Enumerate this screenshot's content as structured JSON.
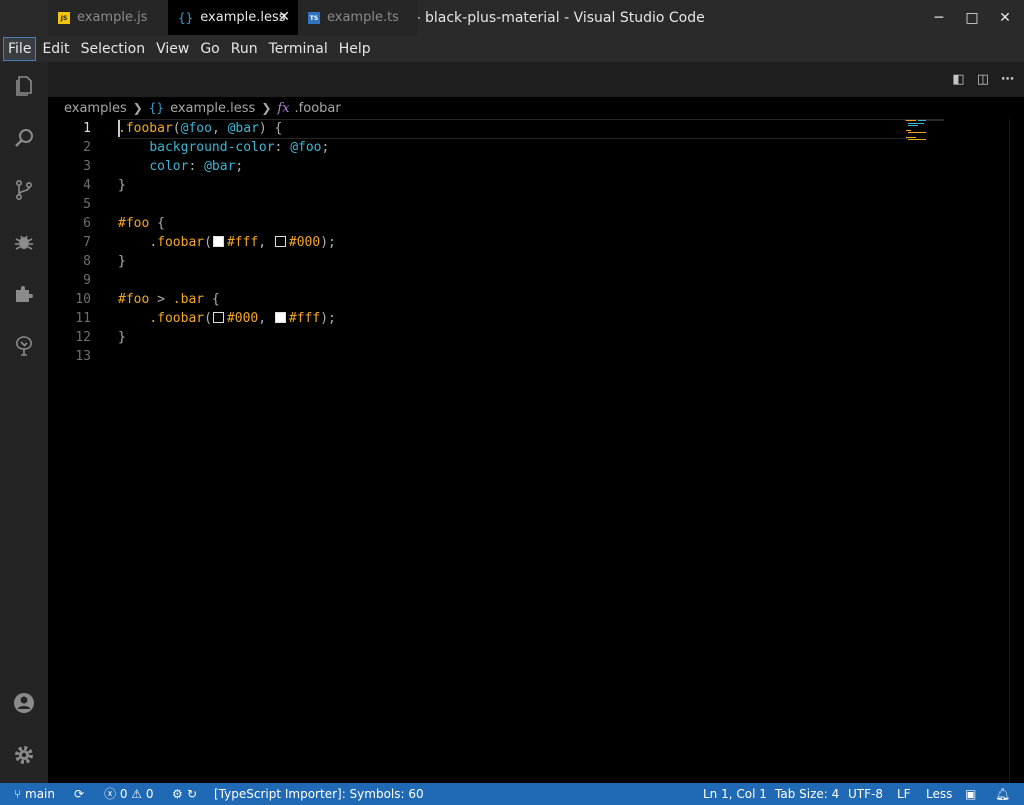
{
  "window": {
    "title": "example.less - black-plus-material - Visual Studio Code",
    "minimize": "─",
    "maximize": "□",
    "close": "✕"
  },
  "menu": [
    "File",
    "Edit",
    "Selection",
    "View",
    "Go",
    "Run",
    "Terminal",
    "Help"
  ],
  "activity_bar": [
    "explorer-icon",
    "search-icon",
    "source-control-icon",
    "debug-icon",
    "extensions-icon",
    "tree-icon",
    "account-icon",
    "settings-gear-icon"
  ],
  "tabs": [
    {
      "label": "example.js",
      "icon": "JS",
      "icon_color": "#f1c40f",
      "active": false
    },
    {
      "label": "example.less",
      "icon": "{}",
      "icon_color": "#3d9bd6",
      "active": true
    },
    {
      "label": "example.ts",
      "icon": "TS",
      "icon_color": "#2f74c0",
      "active": false
    }
  ],
  "tab_close": "✕",
  "breadcrumbs": {
    "folder": "examples",
    "file": "example.less",
    "file_icon": "{}",
    "symbol": ".foobar",
    "symbol_icon": "fx"
  },
  "editor": {
    "line_numbers": [
      "1",
      "2",
      "3",
      "4",
      "5",
      "6",
      "7",
      "8",
      "9",
      "10",
      "11",
      "12",
      "13"
    ],
    "current_line": 1
  },
  "code": {
    "l1": {
      "sel": ".foobar",
      "p1": "(",
      "v1": "@foo",
      "p2": ", ",
      "v2": "@bar",
      "p3": ") {"
    },
    "l2": {
      "prop": "background-color",
      "p1": ": ",
      "v1": "@foo",
      "p2": ";"
    },
    "l3": {
      "prop": "color",
      "p1": ": ",
      "v1": "@bar",
      "p2": ";"
    },
    "l4": {
      "p1": "}"
    },
    "l6": {
      "sel": "#foo",
      "p1": " {"
    },
    "l7": {
      "sel": ".foobar",
      "p1": "(",
      "hex1": "#fff",
      "p2": ", ",
      "hex2": "#000",
      "p3": ");"
    },
    "l8": {
      "p1": "}"
    },
    "l10": {
      "sel1": "#foo",
      "p1": " > ",
      "sel2": ".bar",
      "p2": " {"
    },
    "l11": {
      "sel": ".foobar",
      "p1": "(",
      "hex1": "#000",
      "p2": ", ",
      "hex2": "#fff",
      "p3": ");"
    },
    "l12": {
      "p1": "}"
    }
  },
  "status": {
    "branch": "main",
    "errors": "0",
    "warnings": "0",
    "importer": "[TypeScript Importer]: Symbols: 60",
    "position": "Ln 1, Col 1",
    "tab_size": "Tab Size: 4",
    "encoding": "UTF-8",
    "eol": "LF",
    "language": "Less"
  },
  "colors": {
    "statusbar": "#1f69b5",
    "selector": "#f5a623",
    "variable": "#3bb5d4"
  }
}
